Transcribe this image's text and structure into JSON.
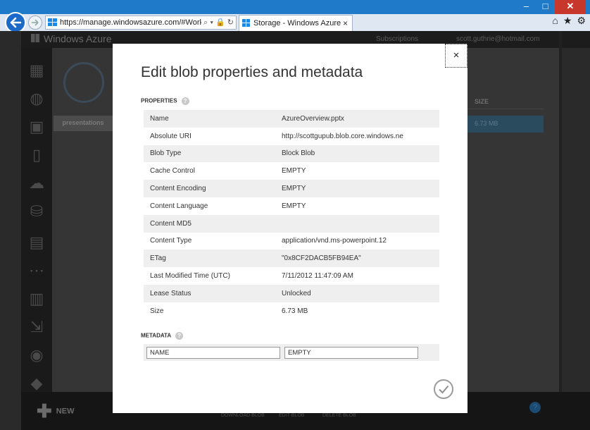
{
  "window": {
    "minimize": "–",
    "maximize": "□",
    "close": "✕"
  },
  "browser": {
    "url": "https://manage.windowsazure.com/#Workspa",
    "address_icons": "⌕ ▾ 🔒 ↻",
    "tab_title": "Storage - Windows Azure",
    "tab_close": "×",
    "right_icons": [
      "⌂",
      "★",
      "⚙"
    ]
  },
  "portal": {
    "brand": "Windows Azure",
    "subscriptions": "Subscriptions",
    "user": "scott.guthrie@hotmail.com",
    "container_tab": "presentations",
    "size_header": "SIZE",
    "size_value": "6.73 MB",
    "new_label": "NEW",
    "bottom_actions": [
      "DOWNLOAD BLOB",
      "EDIT BLOB",
      "DELETE BLOB"
    ],
    "help": "?"
  },
  "modal": {
    "title": "Edit blob properties and metadata",
    "close": "×",
    "properties_label": "PROPERTIES",
    "metadata_label": "METADATA",
    "help_glyph": "?",
    "properties": [
      {
        "name": "Name",
        "value": "AzureOverview.pptx"
      },
      {
        "name": "Absolute URI",
        "value": "http://scottgupub.blob.core.windows.ne"
      },
      {
        "name": "Blob Type",
        "value": "Block Blob"
      },
      {
        "name": "Cache Control",
        "value": "EMPTY"
      },
      {
        "name": "Content Encoding",
        "value": "EMPTY"
      },
      {
        "name": "Content Language",
        "value": "EMPTY"
      },
      {
        "name": "Content MD5",
        "value": ""
      },
      {
        "name": "Content Type",
        "value": "application/vnd.ms-powerpoint.12"
      },
      {
        "name": "ETag",
        "value": "\"0x8CF2DACB5FB94EA\""
      },
      {
        "name": "Last Modified Time (UTC)",
        "value": "7/11/2012 11:47:09 AM"
      },
      {
        "name": "Lease Status",
        "value": "Unlocked"
      },
      {
        "name": "Size",
        "value": "6.73 MB"
      }
    ],
    "metadata": {
      "name_value": "NAME",
      "value_value": "EMPTY"
    }
  }
}
